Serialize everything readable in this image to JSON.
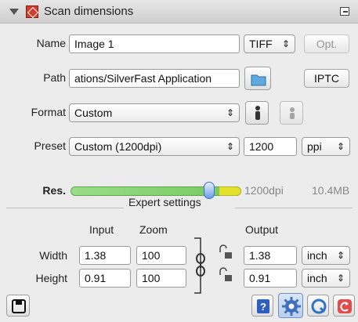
{
  "header": {
    "title": "Scan dimensions"
  },
  "name_row": {
    "label": "Name",
    "value": "Image 1",
    "format_value": "TIFF",
    "opt_label": "Opt."
  },
  "path_row": {
    "label": "Path",
    "value": "ations/SilverFast Application",
    "iptc_label": "IPTC"
  },
  "format_row": {
    "label": "Format",
    "value": "Custom"
  },
  "preset_row": {
    "label": "Preset",
    "value": "Custom (1200dpi)",
    "resolution_value": "1200",
    "unit": "ppi"
  },
  "res_row": {
    "label": "Res.",
    "dpi": "1200dpi",
    "size": "10.4MB",
    "slider_level": 0.81
  },
  "expert": {
    "title": "Expert settings"
  },
  "columns": {
    "input": "Input",
    "zoom": "Zoom",
    "output": "Output"
  },
  "width_row": {
    "label": "Width",
    "input": "1.38",
    "zoom": "100",
    "output": "1.38",
    "unit": "inch"
  },
  "height_row": {
    "label": "Height",
    "input": "0.91",
    "zoom": "100",
    "output": "0.91",
    "unit": "inch"
  },
  "icons": {
    "panel_icon": "scan-frame-icon",
    "folder": "folder-icon",
    "save": "floppy-disk-icon",
    "help": "help-icon",
    "settings": "gear-icon",
    "qualitycheck": "q-icon",
    "reset": "reset-icon"
  },
  "colors": {
    "accent_blue": "#3f6fbf",
    "slider_green": "#73c85f",
    "slider_yellow": "#e2e02d",
    "reset_red": "#e24b4b"
  }
}
